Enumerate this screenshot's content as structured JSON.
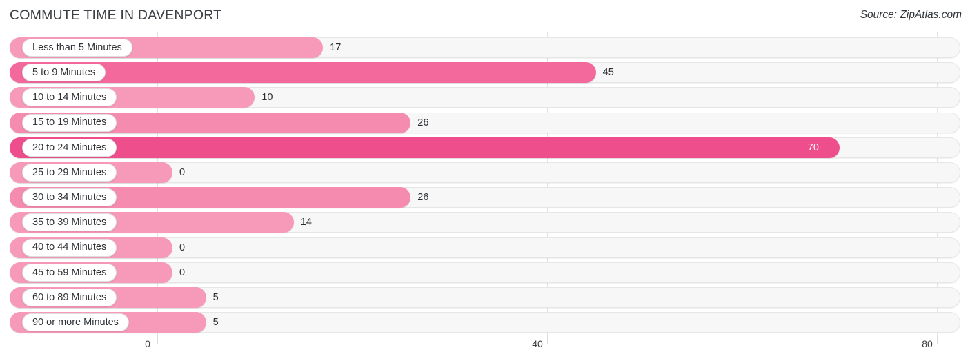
{
  "header": {
    "title": "COMMUTE TIME IN DAVENPORT",
    "source": "Source: ZipAtlas.com"
  },
  "colors": {
    "bar_light": "#f79ab9",
    "bar_mid": "#f58cb0",
    "bar_strong": "#f4699c",
    "bar_darkest": "#ef4e8c",
    "track_bg": "#f7f7f7",
    "track_border": "#e6e6e6",
    "gridline": "#e3e3e3",
    "title_text": "#3c4044",
    "value_text": "#2a2e32",
    "value_text_inside": "#ffffff"
  },
  "chart_data": {
    "type": "bar",
    "orientation": "horizontal",
    "title": "COMMUTE TIME IN DAVENPORT",
    "xlabel": "",
    "ylabel": "",
    "xlim": [
      0,
      80
    ],
    "grid": true,
    "legend": "none",
    "xticks": [
      "0",
      "40",
      "80"
    ],
    "xtick_values": [
      0,
      40,
      80
    ],
    "categories": [
      "Less than 5 Minutes",
      "5 to 9 Minutes",
      "10 to 14 Minutes",
      "15 to 19 Minutes",
      "20 to 24 Minutes",
      "25 to 29 Minutes",
      "30 to 34 Minutes",
      "35 to 39 Minutes",
      "40 to 44 Minutes",
      "45 to 59 Minutes",
      "60 to 89 Minutes",
      "90 or more Minutes"
    ],
    "values": [
      17,
      45,
      10,
      26,
      70,
      0,
      26,
      14,
      0,
      0,
      5,
      5
    ],
    "value_labels": [
      "17",
      "45",
      "10",
      "26",
      "70",
      "0",
      "26",
      "14",
      "0",
      "0",
      "5",
      "5"
    ]
  }
}
